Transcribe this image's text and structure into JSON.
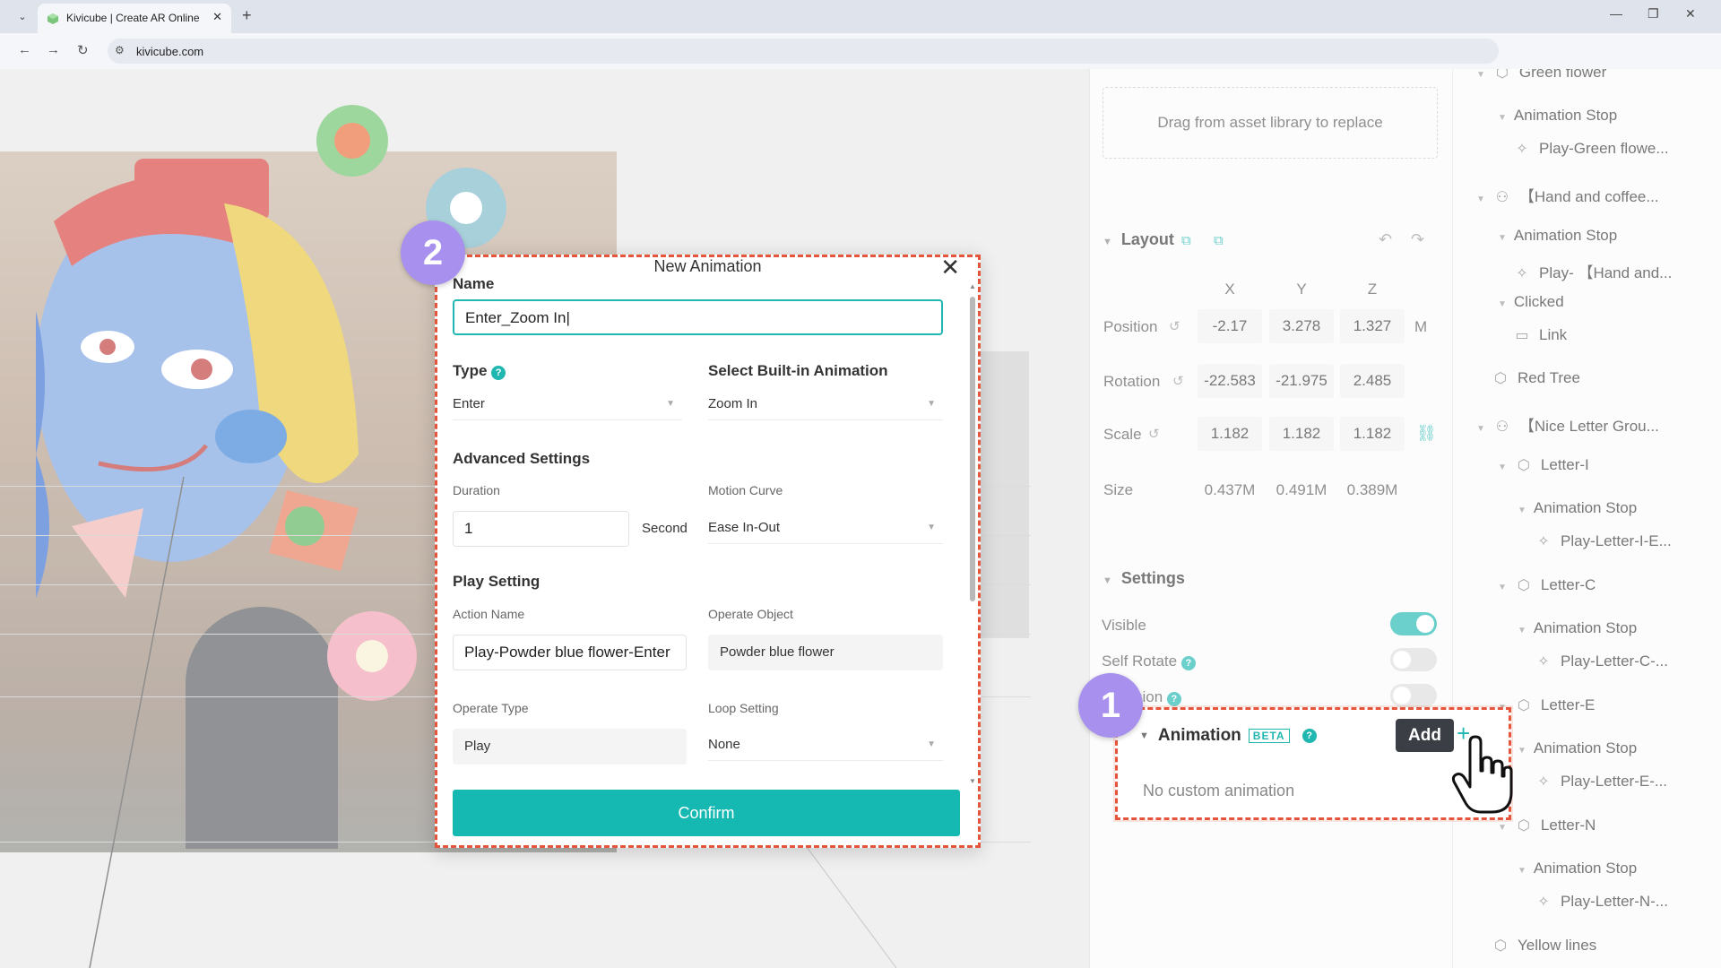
{
  "browser": {
    "tab_title": "Kivicube | Create AR Online -",
    "url": "kivicube.com"
  },
  "properties": {
    "drag_hint": "Drag from asset library to replace",
    "layout": {
      "title": "Layout",
      "axes": [
        "X",
        "Y",
        "Z"
      ],
      "position": {
        "label": "Position",
        "values": [
          "-2.17",
          "3.278",
          "1.327"
        ],
        "unit": "M"
      },
      "rotation": {
        "label": "Rotation",
        "values": [
          "-22.583",
          "-21.975",
          "2.485"
        ]
      },
      "scale": {
        "label": "Scale",
        "values": [
          "1.182",
          "1.182",
          "1.182"
        ]
      },
      "size": {
        "label": "Size",
        "values": [
          "0.437M",
          "0.491M",
          "0.389M"
        ]
      }
    },
    "settings": {
      "title": "Settings",
      "visible_label": "Visible",
      "visible_on": true,
      "self_rotate_label": "Self Rotate",
      "third_label": "sion"
    },
    "animation": {
      "title": "Animation",
      "beta": "BETA",
      "add_tooltip": "Add",
      "empty_text": "No custom animation"
    }
  },
  "scene_tree": {
    "items": [
      {
        "label": "Green flower"
      },
      {
        "label": "Animation Stop"
      },
      {
        "label": "Play-Green flowe..."
      },
      {
        "label": "【Hand and coffee..."
      },
      {
        "label": "Animation Stop"
      },
      {
        "label": "Play- 【Hand and..."
      },
      {
        "label": "Clicked"
      },
      {
        "label": "Link"
      },
      {
        "label": "Red Tree"
      },
      {
        "label": "【Nice Letter Grou..."
      },
      {
        "label": "Letter-I"
      },
      {
        "label": "Animation Stop"
      },
      {
        "label": "Play-Letter-I-E..."
      },
      {
        "label": "Letter-C"
      },
      {
        "label": "Animation Stop"
      },
      {
        "label": "Play-Letter-C-..."
      },
      {
        "label": "Letter-E"
      },
      {
        "label": "Animation Stop"
      },
      {
        "label": "Play-Letter-E-..."
      },
      {
        "label": "Letter-N"
      },
      {
        "label": "Animation Stop"
      },
      {
        "label": "Play-Letter-N-..."
      },
      {
        "label": "Yellow lines"
      }
    ]
  },
  "modal": {
    "title": "New Animation",
    "name_label": "Name",
    "name_value": "Enter_Zoom In",
    "type_label": "Type",
    "type_value": "Enter",
    "builtin_label": "Select Built-in Animation",
    "builtin_value": "Zoom In",
    "advanced_label": "Advanced Settings",
    "duration_label": "Duration",
    "duration_value": "1",
    "duration_unit": "Second",
    "curve_label": "Motion Curve",
    "curve_value": "Ease In-Out",
    "play_setting_label": "Play Setting",
    "action_name_label": "Action Name",
    "action_name_value": "Play-Powder blue flower-Enter",
    "operate_object_label": "Operate Object",
    "operate_object_value": "Powder blue flower",
    "operate_type_label": "Operate Type",
    "operate_type_value": "Play",
    "loop_label": "Loop Setting",
    "loop_value": "None",
    "confirm_label": "Confirm"
  },
  "badges": {
    "step1": "1",
    "step2": "2"
  },
  "colors": {
    "accent": "#16b8b2",
    "highlight": "#e5553b",
    "badge": "#a891ee"
  }
}
